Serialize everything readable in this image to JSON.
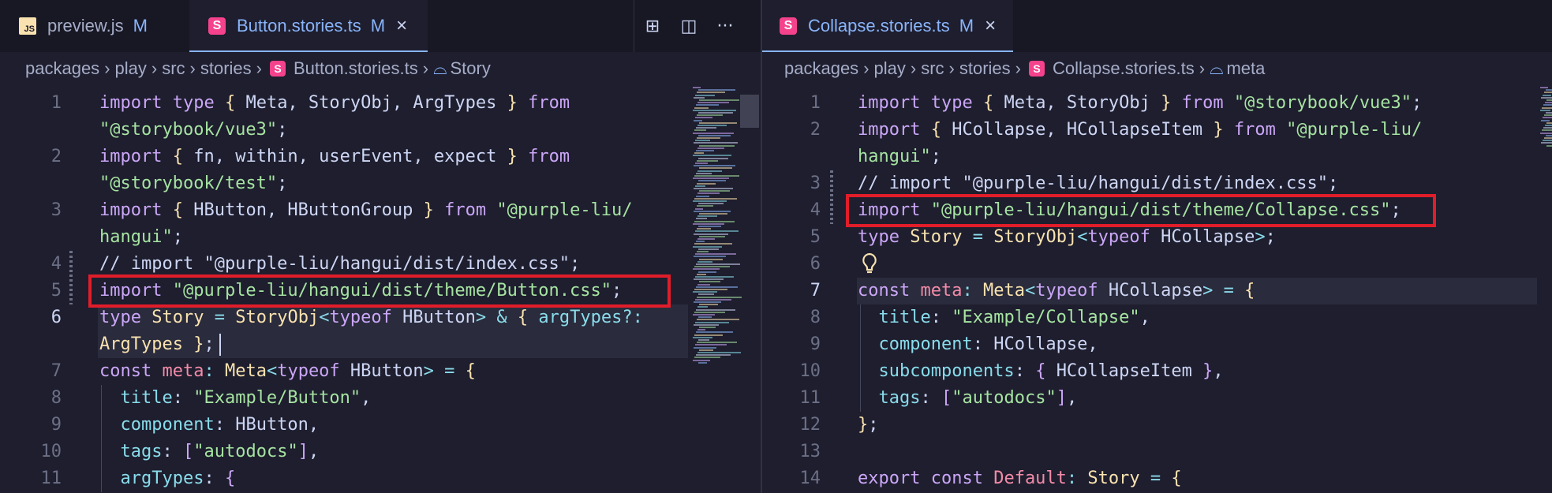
{
  "left": {
    "tabs": [
      {
        "label": "preview.js",
        "status": "M",
        "icon": "javascript-file-icon",
        "active": false
      },
      {
        "label": "Button.stories.ts",
        "status": "M",
        "icon": "storybook-file-icon",
        "active": true,
        "close": "×"
      }
    ],
    "actions": [
      {
        "name": "open-changes-icon",
        "glyph": "⊞"
      },
      {
        "name": "split-editor-icon",
        "glyph": "◫"
      },
      {
        "name": "more-actions-icon",
        "glyph": "···"
      }
    ],
    "breadcrumb": [
      "packages",
      "play",
      "src",
      "stories",
      "Button.stories.ts",
      "Story"
    ],
    "line_numbers": [
      "1",
      "",
      "2",
      "",
      "3",
      "",
      "4",
      "5",
      "6",
      "",
      "7",
      "8",
      "9",
      "10",
      "11"
    ],
    "lines": [
      [
        [
          "import ",
          "k"
        ],
        [
          "type ",
          "k"
        ],
        [
          "{ ",
          "b1"
        ],
        [
          "Meta, StoryObj, ArgTypes ",
          "c"
        ],
        [
          "} ",
          "b1"
        ],
        [
          "from",
          "k"
        ]
      ],
      [
        [
          "\"@storybook/vue3\"",
          "s"
        ],
        [
          ";",
          "c"
        ]
      ],
      [
        [
          "import ",
          "k"
        ],
        [
          "{ ",
          "b1"
        ],
        [
          "fn, within, userEvent, expect ",
          "c"
        ],
        [
          "} ",
          "b1"
        ],
        [
          "from",
          "k"
        ]
      ],
      [
        [
          "\"@storybook/test\"",
          "s"
        ],
        [
          ";",
          "c"
        ]
      ],
      [
        [
          "import ",
          "k"
        ],
        [
          "{ ",
          "b1"
        ],
        [
          "HButton, HButtonGroup ",
          "c"
        ],
        [
          "} ",
          "b1"
        ],
        [
          "from ",
          "k"
        ],
        [
          "\"@purple-liu/",
          "s"
        ]
      ],
      [
        [
          "hangui\"",
          "s"
        ],
        [
          ";",
          "c"
        ]
      ],
      [
        [
          "// import \"@purple-liu/hangui/dist/index.css\";",
          "c"
        ]
      ],
      [
        [
          "import ",
          "k"
        ],
        [
          "\"@purple-liu/hangui/dist/theme/Button.css\"",
          "s"
        ],
        [
          ";",
          "c"
        ]
      ],
      [
        [
          "type ",
          "k"
        ],
        [
          "Story ",
          "t"
        ],
        [
          "= ",
          "p"
        ],
        [
          "StoryObj",
          "t"
        ],
        [
          "<",
          "p"
        ],
        [
          "typeof ",
          "k"
        ],
        [
          "HButton",
          "c"
        ],
        [
          "> ",
          "p"
        ],
        [
          "& ",
          "p"
        ],
        [
          "{ ",
          "b1"
        ],
        [
          "argTypes",
          "p"
        ],
        [
          "?: ",
          "p"
        ]
      ],
      [
        [
          "ArgTypes ",
          "t"
        ],
        [
          "}",
          "b1"
        ],
        [
          ";",
          "c"
        ]
      ],
      [
        [
          "const ",
          "k"
        ],
        [
          "meta",
          "v"
        ],
        [
          ": ",
          "p"
        ],
        [
          "Meta",
          "t"
        ],
        [
          "<",
          "p"
        ],
        [
          "typeof ",
          "k"
        ],
        [
          "HButton",
          "c"
        ],
        [
          "> ",
          "p"
        ],
        [
          "= ",
          "p"
        ],
        [
          "{",
          "b1"
        ]
      ],
      [
        [
          "  title",
          "p"
        ],
        [
          ": ",
          "c"
        ],
        [
          "\"Example/Button\"",
          "s"
        ],
        [
          ",",
          "c"
        ]
      ],
      [
        [
          "  component",
          "p"
        ],
        [
          ": ",
          "c"
        ],
        [
          "HButton,",
          "c"
        ]
      ],
      [
        [
          "  tags",
          "p"
        ],
        [
          ": ",
          "c"
        ],
        [
          "[",
          "b2"
        ],
        [
          "\"autodocs\"",
          "s"
        ],
        [
          "]",
          "b2"
        ],
        [
          ",",
          "c"
        ]
      ],
      [
        [
          "  argTypes",
          "p"
        ],
        [
          ": ",
          "c"
        ],
        [
          "{",
          "b2"
        ]
      ]
    ]
  },
  "right": {
    "tabs": [
      {
        "label": "Collapse.stories.ts",
        "status": "M",
        "icon": "storybook-file-icon",
        "active": true,
        "close": "×"
      }
    ],
    "breadcrumb": [
      "packages",
      "play",
      "src",
      "stories",
      "Collapse.stories.ts",
      "meta"
    ],
    "line_numbers": [
      "1",
      "2",
      "",
      "3",
      "4",
      "5",
      "6",
      "7",
      "8",
      "9",
      "10",
      "11",
      "12",
      "13",
      "14"
    ],
    "lines": [
      [
        [
          "import ",
          "k"
        ],
        [
          "type ",
          "k"
        ],
        [
          "{ ",
          "b1"
        ],
        [
          "Meta, StoryObj ",
          "c"
        ],
        [
          "} ",
          "b1"
        ],
        [
          "from ",
          "k"
        ],
        [
          "\"@storybook/vue3\"",
          "s"
        ],
        [
          ";",
          "c"
        ]
      ],
      [
        [
          "import ",
          "k"
        ],
        [
          "{ ",
          "b1"
        ],
        [
          "HCollapse, HCollapseItem ",
          "c"
        ],
        [
          "} ",
          "b1"
        ],
        [
          "from ",
          "k"
        ],
        [
          "\"@purple-liu/",
          "s"
        ]
      ],
      [
        [
          "hangui\"",
          "s"
        ],
        [
          ";",
          "c"
        ]
      ],
      [
        [
          "// import \"@purple-liu/hangui/dist/index.css\";",
          "c"
        ]
      ],
      [
        [
          "import ",
          "k"
        ],
        [
          "\"@purple-liu/hangui/dist/theme/Collapse.css\"",
          "s"
        ],
        [
          ";",
          "c"
        ]
      ],
      [
        [
          "type ",
          "k"
        ],
        [
          "Story ",
          "t"
        ],
        [
          "= ",
          "p"
        ],
        [
          "StoryObj",
          "t"
        ],
        [
          "<",
          "p"
        ],
        [
          "typeof ",
          "k"
        ],
        [
          "HCollapse",
          "c"
        ],
        [
          ">",
          "p"
        ],
        [
          ";",
          "c"
        ]
      ],
      [],
      [
        [
          "const ",
          "k"
        ],
        [
          "meta",
          "v"
        ],
        [
          ": ",
          "p"
        ],
        [
          "Meta",
          "t"
        ],
        [
          "<",
          "p"
        ],
        [
          "typeof ",
          "k"
        ],
        [
          "HCollapse",
          "c"
        ],
        [
          "> ",
          "p"
        ],
        [
          "= ",
          "p"
        ],
        [
          "{",
          "b1"
        ]
      ],
      [
        [
          "  title",
          "p"
        ],
        [
          ": ",
          "c"
        ],
        [
          "\"Example/Collapse\"",
          "s"
        ],
        [
          ",",
          "c"
        ]
      ],
      [
        [
          "  component",
          "p"
        ],
        [
          ": ",
          "c"
        ],
        [
          "HCollapse,",
          "c"
        ]
      ],
      [
        [
          "  subcomponents",
          "p"
        ],
        [
          ": ",
          "c"
        ],
        [
          "{ ",
          "b2"
        ],
        [
          "HCollapseItem ",
          "c"
        ],
        [
          "}",
          "b2"
        ],
        [
          ",",
          "c"
        ]
      ],
      [
        [
          "  tags",
          "p"
        ],
        [
          ": ",
          "c"
        ],
        [
          "[",
          "b2"
        ],
        [
          "\"autodocs\"",
          "s"
        ],
        [
          "]",
          "b2"
        ],
        [
          ",",
          "c"
        ]
      ],
      [
        [
          "}",
          "b1"
        ],
        [
          ";",
          "c"
        ]
      ],
      [],
      [
        [
          "export ",
          "k"
        ],
        [
          "const ",
          "k"
        ],
        [
          "Default",
          "v"
        ],
        [
          ": ",
          "p"
        ],
        [
          "Story ",
          "t"
        ],
        [
          "= ",
          "p"
        ],
        [
          "{",
          "b1"
        ]
      ]
    ]
  }
}
